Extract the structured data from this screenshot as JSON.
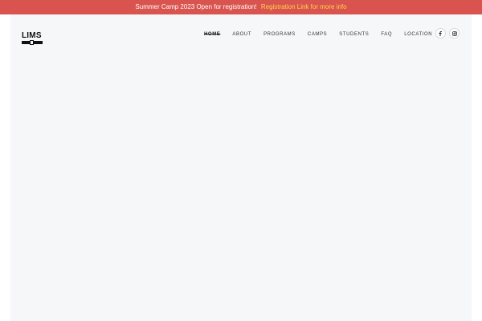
{
  "announcement": {
    "text": "Summer Camp 2023 Open for registration!",
    "link_text": "Registration Link for more info",
    "bar_color": "#d9534f",
    "link_color": "#ffd54a"
  },
  "header": {
    "logo_text": "LIMS"
  },
  "nav": {
    "items": [
      {
        "label": "HOME"
      },
      {
        "label": "ABOUT"
      },
      {
        "label": "PROGRAMS"
      },
      {
        "label": "CAMPS"
      },
      {
        "label": "STUDENTS"
      },
      {
        "label": "FAQ"
      },
      {
        "label": "LOCATION"
      }
    ],
    "active": "HOME"
  },
  "social": {
    "icons": [
      "facebook-icon",
      "instagram-icon"
    ]
  }
}
